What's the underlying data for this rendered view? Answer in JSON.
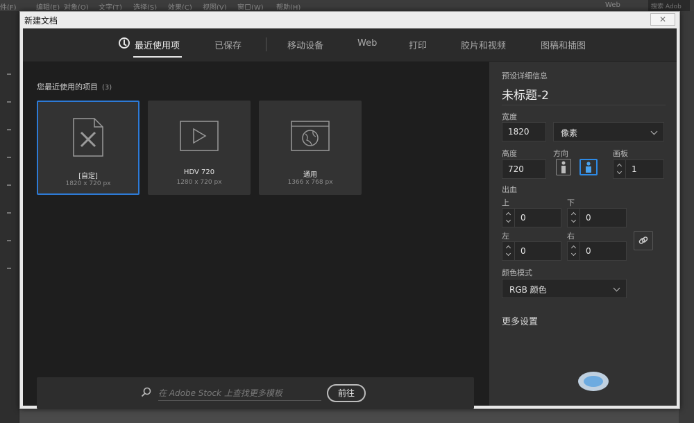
{
  "background_app": {
    "menu_items": [
      "件(F)",
      "编辑(E)",
      "对象(O)",
      "文字(T)",
      "选择(S)",
      "效果(C)",
      "视图(V)",
      "窗口(W)",
      "帮助(H)"
    ],
    "workspace_label": "Web",
    "search_placeholder": "搜索 Adob"
  },
  "dialog": {
    "title": "新建文档",
    "close_label": "✕",
    "tabs": [
      {
        "label": "最近使用项",
        "active": true
      },
      {
        "label": "已保存"
      },
      {
        "label": "移动设备"
      },
      {
        "label": "Web"
      },
      {
        "label": "打印"
      },
      {
        "label": "胶片和视频"
      },
      {
        "label": "图稿和插图"
      }
    ],
    "recent": {
      "title": "您最近使用的项目",
      "count": "(3)",
      "items": [
        {
          "name": "[自定]",
          "size": "1820 x 720 px",
          "icon": "custom-doc-icon",
          "selected": true
        },
        {
          "name": "HDV 720",
          "size": "1280 x 720 px",
          "icon": "video-play-icon"
        },
        {
          "name": "通用",
          "size": "1366 x 768 px",
          "icon": "web-globe-icon"
        }
      ]
    },
    "stock": {
      "placeholder": "在 Adobe Stock 上查找更多模板",
      "go_label": "前往"
    },
    "preset": {
      "section_title": "预设详细信息",
      "doc_name": "未标题-2",
      "width_label": "宽度",
      "width_value": "1820",
      "unit": "像素",
      "height_label": "高度",
      "height_value": "720",
      "orientation_label": "方向",
      "artboards_label": "画板",
      "artboards_value": "1",
      "bleed_label": "出血",
      "bleed_top_label": "上",
      "bleed_top": "0",
      "bleed_bottom_label": "下",
      "bleed_bottom": "0",
      "bleed_left_label": "左",
      "bleed_left": "0",
      "bleed_right_label": "右",
      "bleed_right": "0",
      "color_mode_label": "颜色模式",
      "color_mode": "RGB 颜色",
      "more_settings": "更多设置"
    }
  },
  "colors": {
    "accent_blue": "#2d7ad6",
    "dialog_bg": "#1e1e1e",
    "panel_bg": "#323232"
  }
}
